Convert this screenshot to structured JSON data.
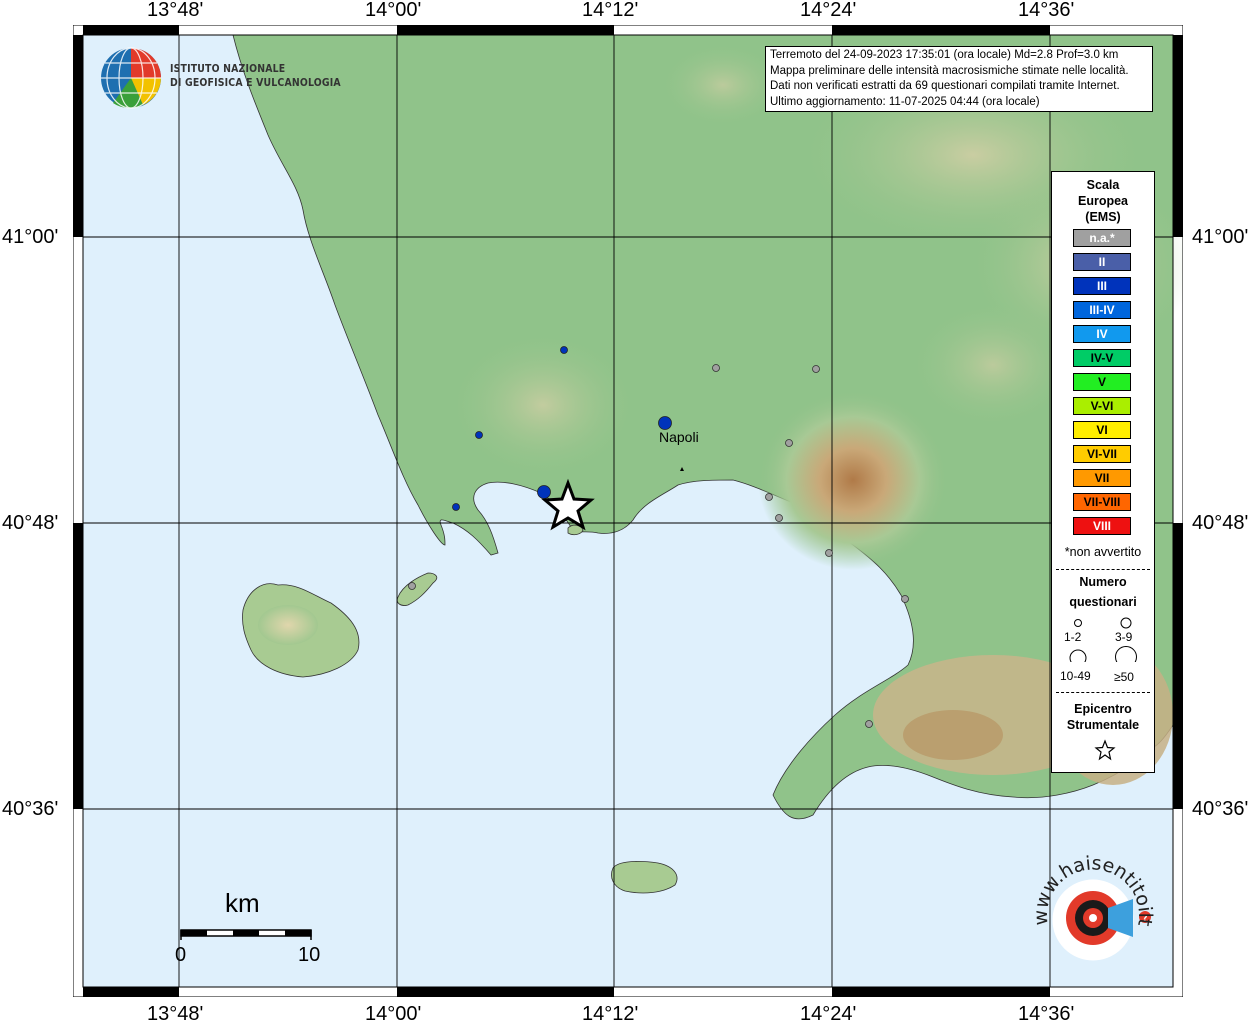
{
  "header": {
    "line1": "Terremoto del 24-09-2023 17:35:01 (ora locale) Md=2.8 Prof=3.0 km",
    "line2": "Mappa preliminare delle intensità macrosismiche stimate nelle località.",
    "line3": "Dati non verificati estratti da 69 questionari compilati tramite Internet.",
    "line4": "Ultimo aggiornamento: 11-07-2025 04:44 (ora locale)"
  },
  "institute": {
    "line1": "ISTITUTO NAZIONALE",
    "line2": "DI GEOFISICA E VULCANOLOGIA"
  },
  "axes": {
    "top_ticks": [
      "13°48'",
      "14°00'",
      "14°12'",
      "14°24'",
      "14°36'"
    ],
    "bottom_ticks": [
      "13°48'",
      "14°00'",
      "14°12'",
      "14°24'",
      "14°36'"
    ],
    "left_ticks": [
      "41°00'",
      "40°48'",
      "40°36'"
    ],
    "right_ticks": [
      "41°00'",
      "40°48'",
      "40°36'"
    ]
  },
  "places": {
    "napoli": "Napoli"
  },
  "legend": {
    "title1": "Scala",
    "title2": "Europea",
    "title3": "(EMS)",
    "ems": [
      {
        "label": "n.a.*",
        "color": "#a0a0a0",
        "text": "#ffffff"
      },
      {
        "label": "II",
        "color": "#4a5fa8",
        "text": "#ffffff"
      },
      {
        "label": "III",
        "color": "#0033bb",
        "text": "#ffffff"
      },
      {
        "label": "III-IV",
        "color": "#0066dd",
        "text": "#ffffff"
      },
      {
        "label": "IV",
        "color": "#1199ee",
        "text": "#ffffff"
      },
      {
        "label": "IV-V",
        "color": "#00cc66",
        "text": "#000000"
      },
      {
        "label": "V",
        "color": "#22ee22",
        "text": "#000000"
      },
      {
        "label": "V-VI",
        "color": "#aaee00",
        "text": "#000000"
      },
      {
        "label": "VI",
        "color": "#ffee00",
        "text": "#000000"
      },
      {
        "label": "VI-VII",
        "color": "#ffcc00",
        "text": "#000000"
      },
      {
        "label": "VII",
        "color": "#ff9900",
        "text": "#000000"
      },
      {
        "label": "VII-VIII",
        "color": "#ff6600",
        "text": "#000000"
      },
      {
        "label": "VIII",
        "color": "#ee1111",
        "text": "#ffffff"
      }
    ],
    "not_felt": "*non avvertito",
    "count_title1": "Numero",
    "count_title2": "questionari",
    "counts": [
      "1-2",
      "3-9",
      "10-49",
      "≥50"
    ],
    "epi_title1": "Epicentro",
    "epi_title2": "Strumentale"
  },
  "scalebar": {
    "unit": "km",
    "start": "0",
    "end": "10"
  },
  "watermark": "www.haisentitoilterremoto.it",
  "colors": {
    "sea": "#dff0fc",
    "land_low": "#8fc48a",
    "land_mid": "#b8d4a0",
    "land_high": "#d9c59a",
    "peak": "#b8895a"
  }
}
